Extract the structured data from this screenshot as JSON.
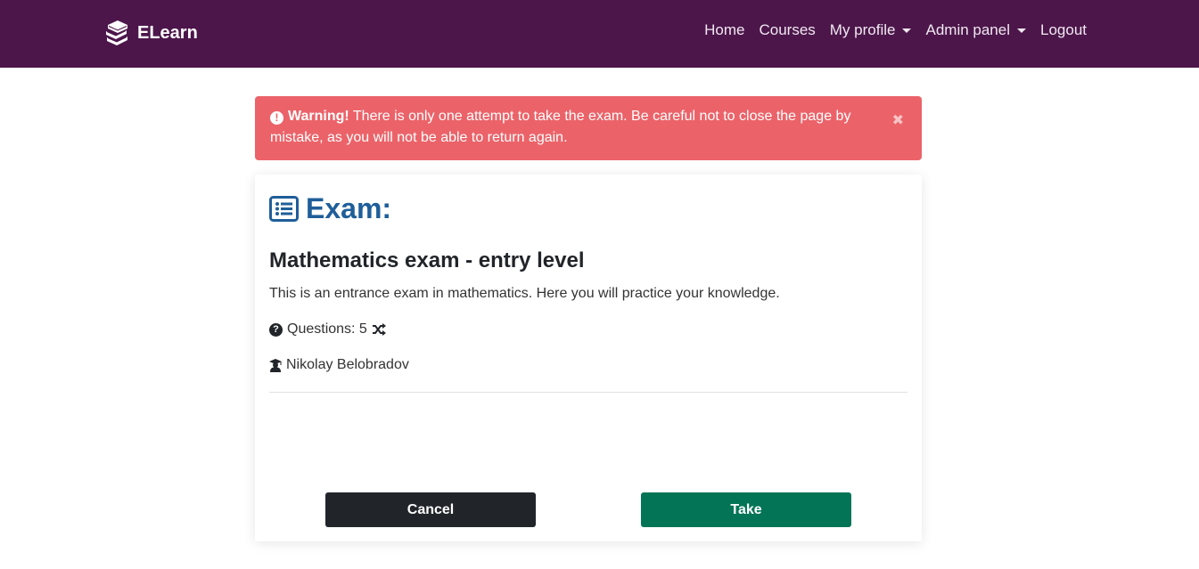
{
  "navbar": {
    "brand": "ELearn",
    "links": {
      "home": "Home",
      "courses": "Courses",
      "profile": "My profile",
      "admin": "Admin panel",
      "logout": "Logout"
    }
  },
  "alert": {
    "strong": "Warning!",
    "message": " There is only one attempt to take the exam. Be careful not to close the page by mistake, as you will not be able to return again.",
    "close": "✖"
  },
  "exam": {
    "heading": "Exam:",
    "title": "Mathematics exam - entry level",
    "description": "This is an entrance exam in mathematics. Here you will practice your knowledge.",
    "questions_label": "Questions: 5",
    "author": "Nikolay Belobradov"
  },
  "buttons": {
    "cancel": "Cancel",
    "take": "Take"
  },
  "colors": {
    "navbar": "#4c164b",
    "alert": "#eb6369",
    "heading": "#1f5e99",
    "cancel": "#212529",
    "take": "#037556"
  }
}
